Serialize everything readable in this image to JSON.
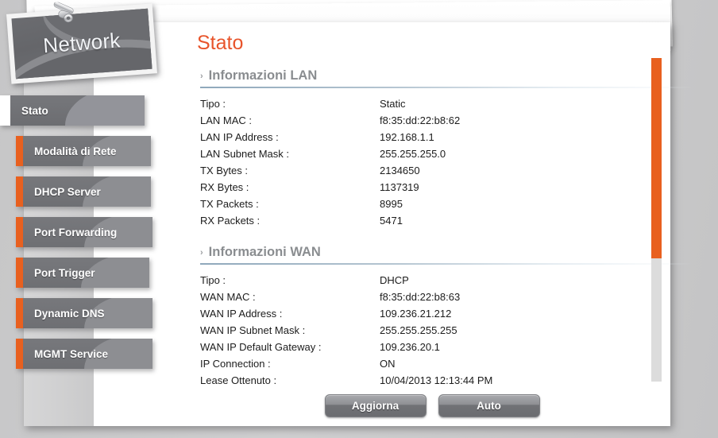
{
  "logo": {
    "text": "Network",
    "clip_icon": "paperclip-icon"
  },
  "sidebar": {
    "items": [
      {
        "label": "Stato",
        "active": true
      },
      {
        "label": "Modalità di Rete",
        "active": false
      },
      {
        "label": "DHCP Server",
        "active": false
      },
      {
        "label": "Port Forwarding",
        "active": false
      },
      {
        "label": "Port Trigger",
        "active": false
      },
      {
        "label": "Dynamic DNS",
        "active": false
      },
      {
        "label": "MGMT Service",
        "active": false
      }
    ]
  },
  "main": {
    "title": "Stato",
    "sections": [
      {
        "heading": "Informazioni LAN",
        "rows": [
          {
            "key": "Tipo :",
            "value": "Static"
          },
          {
            "key": "LAN MAC :",
            "value": "f8:35:dd:22:b8:62"
          },
          {
            "key": "LAN IP Address :",
            "value": "192.168.1.1"
          },
          {
            "key": "LAN Subnet Mask :",
            "value": "255.255.255.0"
          },
          {
            "key": "TX Bytes :",
            "value": "2134650"
          },
          {
            "key": "RX Bytes :",
            "value": "1137319"
          },
          {
            "key": "TX Packets :",
            "value": "8995"
          },
          {
            "key": "RX Packets :",
            "value": "5471"
          }
        ]
      },
      {
        "heading": "Informazioni WAN",
        "rows": [
          {
            "key": "Tipo :",
            "value": "DHCP"
          },
          {
            "key": "WAN MAC :",
            "value": "f8:35:dd:22:b8:63"
          },
          {
            "key": "WAN IP Address :",
            "value": "109.236.21.212"
          },
          {
            "key": "WAN IP Subnet Mask :",
            "value": "255.255.255.255"
          },
          {
            "key": "WAN IP Default Gateway :",
            "value": "109.236.20.1"
          },
          {
            "key": "IP Connection :",
            "value": "ON"
          },
          {
            "key": "Lease Ottenuto :",
            "value": "10/04/2013 12:13:44 PM"
          }
        ]
      }
    ],
    "buttons": [
      {
        "label": "Aggiorna"
      },
      {
        "label": "Auto"
      }
    ]
  },
  "scrollbar": {
    "thumb_percent": 62
  },
  "colors": {
    "accent_orange": "#e8601f",
    "title_orange": "#e8542b",
    "tab_grey": "#6e6f73",
    "heading_grey": "#8a8d90",
    "rule_blue": "#8fa8bb"
  },
  "icons": {
    "section_chevron": "›"
  }
}
